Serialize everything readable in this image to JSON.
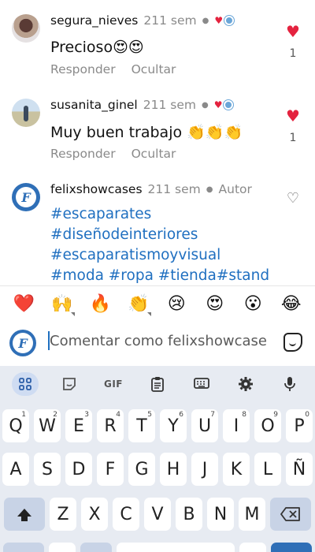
{
  "comments": [
    {
      "user": "segura_nieves",
      "time": "211 sem",
      "text": "Precioso😍😍",
      "actions": [
        "Responder",
        "Ocultar"
      ],
      "likes": "1"
    },
    {
      "user": "susanita_ginel",
      "time": "211 sem",
      "text": "Muy buen trabajo 👏👏👏",
      "actions": [
        "Responder",
        "Ocultar"
      ],
      "likes": "1"
    },
    {
      "user": "felixshowcases",
      "time": "211 sem",
      "tag": "Autor",
      "hashtags": "#escaparates #diseñodeinteriores #escaparatismoyvisual #moda #ropa #tienda#stand"
    }
  ],
  "reactions": [
    "❤️",
    "🙌",
    "🔥",
    "👏",
    "😢",
    "😍",
    "😮",
    "😂"
  ],
  "compose": {
    "placeholder": "Comentar como felixshowcase"
  },
  "keyboard": {
    "toolbar": [
      "apps-icon",
      "sticker-icon",
      "GIF",
      "clipboard-icon",
      "keyboard-icon",
      "gear-icon",
      "mic-icon"
    ],
    "gif_label": "GIF",
    "row1": [
      {
        "k": "Q",
        "n": "1"
      },
      {
        "k": "W",
        "n": "2"
      },
      {
        "k": "E",
        "n": "3"
      },
      {
        "k": "R",
        "n": "4"
      },
      {
        "k": "T",
        "n": "5"
      },
      {
        "k": "Y",
        "n": "6"
      },
      {
        "k": "U",
        "n": "7"
      },
      {
        "k": "I",
        "n": "8"
      },
      {
        "k": "O",
        "n": "9"
      },
      {
        "k": "P",
        "n": "0"
      }
    ],
    "row2": [
      "A",
      "S",
      "D",
      "F",
      "G",
      "H",
      "J",
      "K",
      "L",
      "Ñ"
    ],
    "row3": [
      "Z",
      "X",
      "C",
      "V",
      "B",
      "N",
      "M"
    ]
  },
  "colors": {
    "accent": "#1f6fc0",
    "like": "#e4233f",
    "keyboard_bg": "#e7ebf2"
  }
}
